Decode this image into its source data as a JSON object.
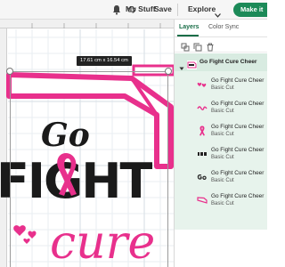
{
  "topbar": {
    "my_stuff_label": "My Stuff",
    "save_label": "Save",
    "explore_label": "Explore",
    "make_label": "Make it"
  },
  "canvas": {
    "size_badge": "17.61 cm x 16.54 cm",
    "design": {
      "word1": "Go",
      "word2": "FIGHT",
      "word3": "Cure",
      "pink": "#e8308c",
      "black": "#1a1a1a"
    }
  },
  "panel": {
    "tabs": [
      "Layers",
      "Color Sync"
    ],
    "group_name": "Go Fight Cure Cheer",
    "layers": [
      {
        "name": "Go Fight Cure Cheer",
        "op": "Basic Cut",
        "thumb": "heart-icon"
      },
      {
        "name": "Go Fight Cure Cheer",
        "op": "Basic Cut",
        "thumb": "cure-text-icon"
      },
      {
        "name": "Go Fight Cure Cheer",
        "op": "Basic Cut",
        "thumb": "ribbon-icon"
      },
      {
        "name": "Go Fight Cure Cheer",
        "op": "Basic Cut",
        "thumb": "fight-text-icon"
      },
      {
        "name": "Go Fight Cure Cheer",
        "op": "Basic Cut",
        "thumb": "go-text-icon"
      },
      {
        "name": "Go Fight Cure Cheer",
        "op": "Basic Cut",
        "thumb": "megaphone-icon"
      }
    ]
  },
  "colors": {
    "accent_green": "#1a6e48",
    "selected_layer_bg": "#d8ebe1",
    "layer_bg": "#e7f3ec"
  }
}
